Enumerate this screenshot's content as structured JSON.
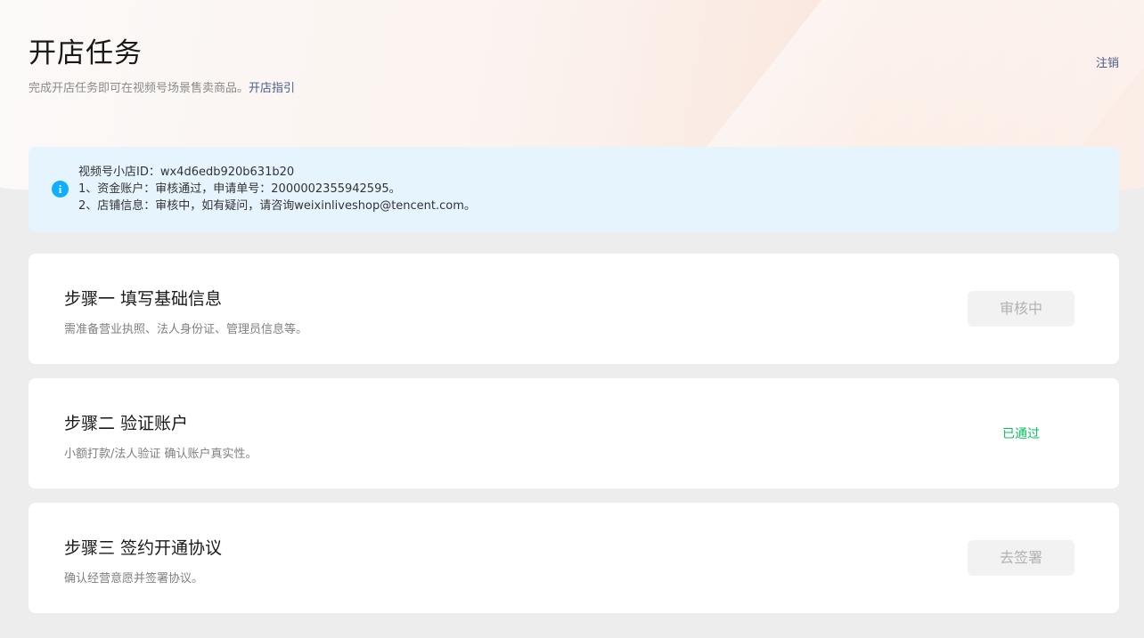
{
  "header": {
    "title": "开店任务",
    "subtitle": "完成开店任务即可在视频号场景售卖商品。",
    "guide_link": "开店指引",
    "logout_label": "注销"
  },
  "info": {
    "lines": [
      "视频号小店ID：wx4d6edb920b631b20",
      "1、资金账户：审核通过，申请单号：2000002355942595。",
      "2、店铺信息：审核中，如有疑问，请咨询weixinliveshop@tencent.com。"
    ]
  },
  "steps": [
    {
      "title": "步骤一 填写基础信息",
      "desc": "需准备营业执照、法人身份证、管理员信息等。",
      "action": "审核中"
    },
    {
      "title": "步骤二 验证账户",
      "desc": "小额打款/法人验证 确认账户真实性。",
      "status": "已通过"
    },
    {
      "title": "步骤三 签约开通协议",
      "desc": "确认经营意愿并签署协议。",
      "action": "去签署"
    }
  ],
  "colors": {
    "page_bg": "#ededed",
    "info_bg": "#e6f4fd",
    "info_icon": "#10aeff",
    "link": "#4a5d8c",
    "success": "#07c160",
    "disabled_text": "#b2b2b2",
    "disabled_bg": "#f2f2f2"
  },
  "icons": {
    "info": "info-circle-icon"
  }
}
